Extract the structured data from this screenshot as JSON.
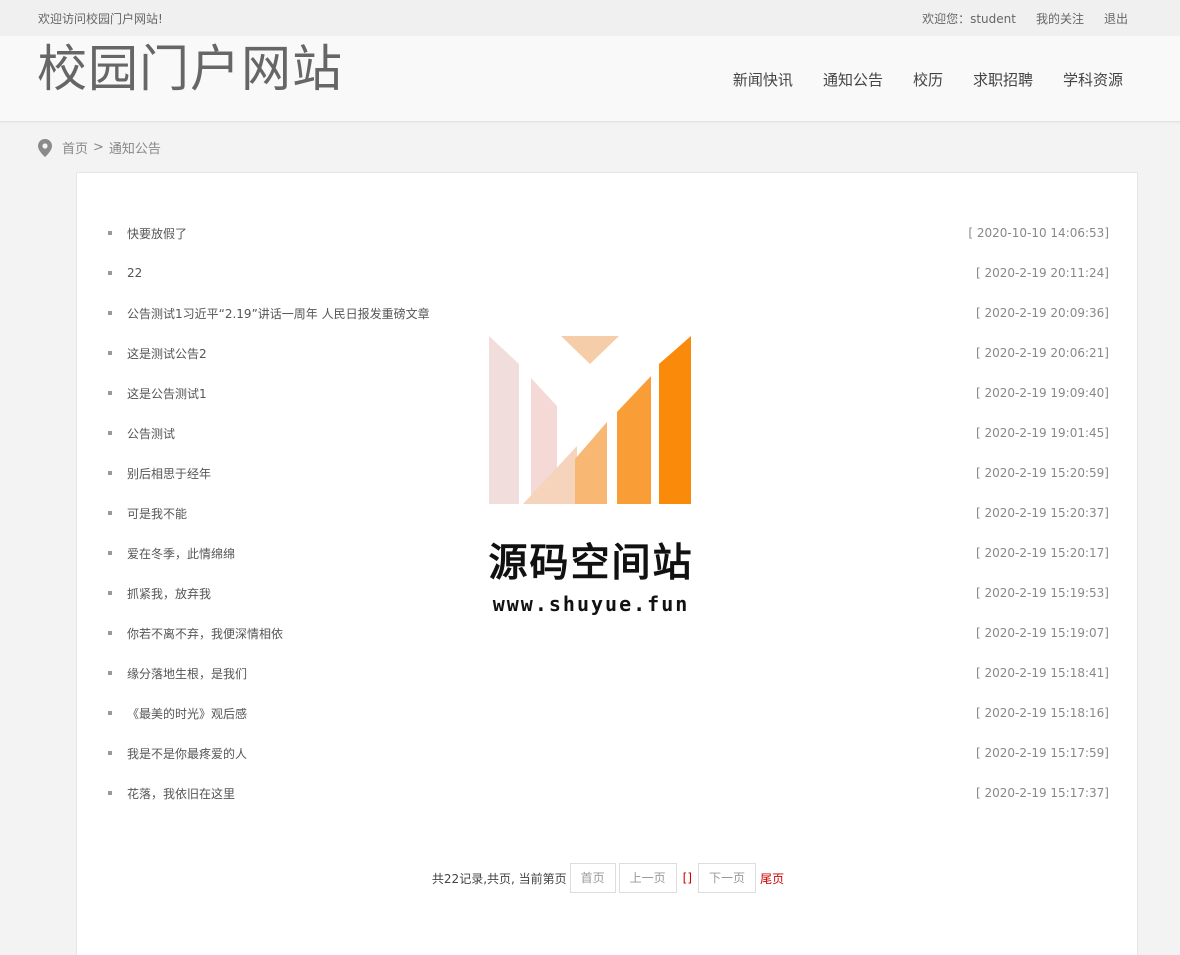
{
  "topbar": {
    "welcome": "欢迎访问校园门户网站!",
    "user_greeting": "欢迎您：student",
    "my_follow": "我的关注",
    "logout": "退出"
  },
  "header": {
    "site_title": "校园门户网站",
    "nav": [
      "新闻快讯",
      "通知公告",
      "校历",
      "求职招聘",
      "学科资源"
    ]
  },
  "breadcrumb": {
    "icon": "map-pin-icon",
    "home": "首页",
    "separator": ">",
    "current": "通知公告"
  },
  "notices": [
    {
      "title": "快要放假了",
      "date": "[ 2020-10-10 14:06:53]"
    },
    {
      "title": "22",
      "date": "[ 2020-2-19 20:11:24]"
    },
    {
      "title": "公告测试1习近平“2.19”讲话一周年 人民日报发重磅文章",
      "date": "[ 2020-2-19 20:09:36]"
    },
    {
      "title": "这是测试公告2",
      "date": "[ 2020-2-19 20:06:21]"
    },
    {
      "title": "这是公告测试1",
      "date": "[ 2020-2-19 19:09:40]"
    },
    {
      "title": "公告测试",
      "date": "[ 2020-2-19 19:01:45]"
    },
    {
      "title": "别后相思于经年",
      "date": "[ 2020-2-19 15:20:59]"
    },
    {
      "title": "可是我不能",
      "date": "[ 2020-2-19 15:20:37]"
    },
    {
      "title": "爱在冬季，此情绵绵",
      "date": "[ 2020-2-19 15:20:17]"
    },
    {
      "title": "抓紧我，放弃我",
      "date": "[ 2020-2-19 15:19:53]"
    },
    {
      "title": "你若不离不弃，我便深情相依",
      "date": "[ 2020-2-19 15:19:07]"
    },
    {
      "title": "缘分落地生根，是我们",
      "date": "[ 2020-2-19 15:18:41]"
    },
    {
      "title": "《最美的时光》观后感",
      "date": "[ 2020-2-19 15:18:16]"
    },
    {
      "title": "我是不是你最疼爱的人",
      "date": "[ 2020-2-19 15:17:59]"
    },
    {
      "title": "花落，我依旧在这里",
      "date": "[ 2020-2-19 15:17:37]"
    }
  ],
  "pager": {
    "summary": "共22记录,共页, 当前第页",
    "first": "首页",
    "prev": "上一页",
    "current": "[]",
    "next": "下一页",
    "last": "尾页"
  },
  "watermark": {
    "name": "源码空间站",
    "url": "www.shuyue.fun",
    "logo": "m-logo-icon"
  },
  "colors": {
    "accent_red": "#cc0000",
    "logo_orange": "#f98a0a",
    "logo_pink": "#f2dddd"
  }
}
